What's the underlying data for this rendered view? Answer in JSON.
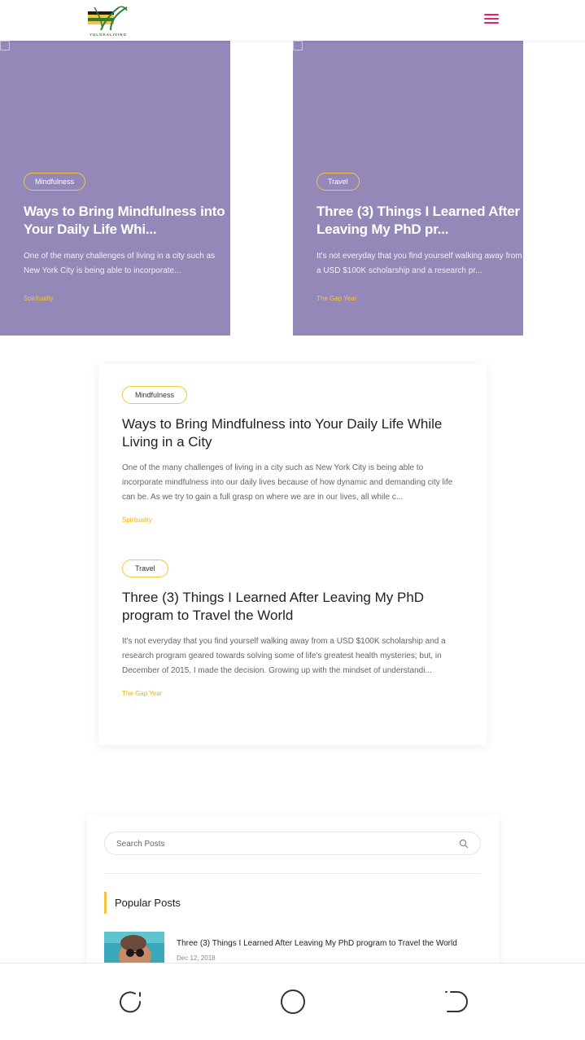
{
  "header": {
    "logo_text": "YULOKALIVING",
    "menu_icon": "hamburger-menu-icon",
    "accent_color": "#e91e63"
  },
  "slider": [
    {
      "category": "Mindfulness",
      "title": "Ways to Bring Mindfulness into Your Daily Life Whi...",
      "excerpt": "One of the many challenges of living in a city such as New York City is being able to incorporate...",
      "tag": "Spirituality"
    },
    {
      "category": "Travel",
      "title": "Three (3) Things I Learned After Leaving My PhD pr...",
      "excerpt": "It's not everyday that you find yourself walking away from a USD $100K scholarship and a research pr...",
      "tag": "The Gap Year"
    }
  ],
  "posts": [
    {
      "category": "Mindfulness",
      "title": "Ways to Bring Mindfulness into Your Daily Life While Living in a City",
      "excerpt": "One of the many challenges of living in a city such as New York City is being able to incorporate mindfulness into our daily lives because of how dynamic and demanding city life can be. As we try to gain a full grasp on where we are in our lives, all while c...",
      "tag": "Spirituality"
    },
    {
      "category": "Travel",
      "title": "Three (3) Things I Learned After Leaving My PhD program to Travel the World",
      "excerpt": "It's not everyday that you find yourself walking away from a USD $100K scholarship and a research program geared towards solving some of life's greatest health mysteries; but, in December of 2015, I made the decision. Growing up with the mindset of understandi...",
      "tag": "The Gap Year"
    }
  ],
  "sidebar": {
    "search_placeholder": "Search Posts",
    "popular_title": "Popular Posts",
    "popular": [
      {
        "title": "Three (3) Things I Learned After Leaving My PhD program to Travel the World",
        "date": "Dec 12, 2018"
      }
    ]
  },
  "colors": {
    "slide_bg": "#9488b8",
    "pill_border": "#f4c542",
    "tag_color": "#f4b400"
  },
  "navbar": {
    "icons": [
      "recent-apps-icon",
      "home-icon",
      "back-icon"
    ]
  }
}
